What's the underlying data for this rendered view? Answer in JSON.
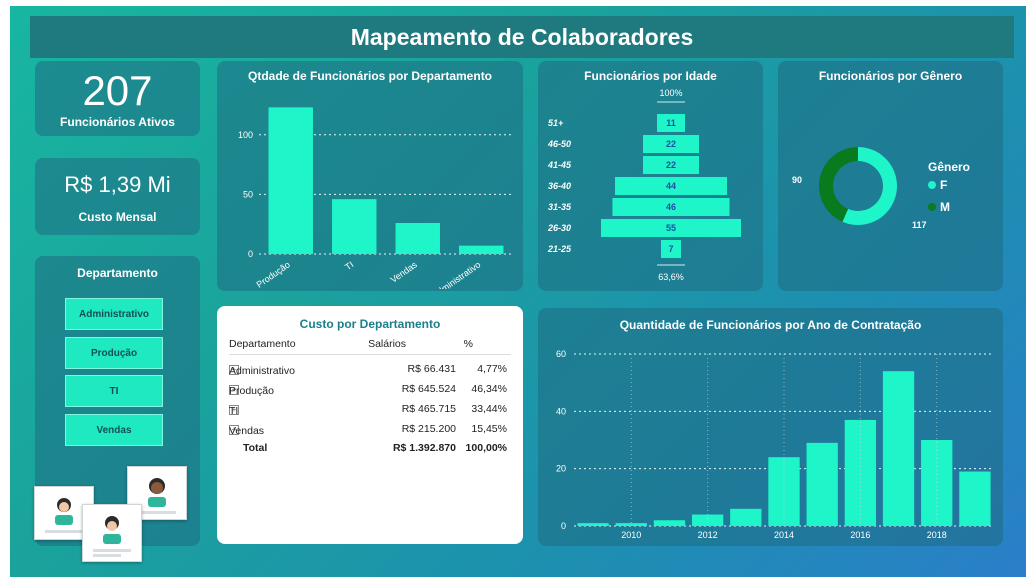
{
  "title": "Mapeamento de Colaboradores",
  "kpis": {
    "employees_value": "207",
    "employees_label": "Funcionários Ativos",
    "cost_value": "R$ 1,39 Mi",
    "cost_label": "Custo Mensal"
  },
  "slicer": {
    "title": "Departamento",
    "items": [
      "Administrativo",
      "Produção",
      "TI",
      "Vendas"
    ]
  },
  "colors": {
    "bar": "#1ef5c8",
    "title_bar": "#1f7a80",
    "male": "#0a7a1e",
    "female": "#1ef5c8"
  },
  "table": {
    "title": "Custo por Departamento",
    "headers": [
      "Departamento",
      "Salários",
      "%"
    ],
    "rows": [
      [
        "Administrativo",
        "R$ 66.431",
        "4,77%"
      ],
      [
        "Produção",
        "R$ 645.524",
        "46,34%"
      ],
      [
        "TI",
        "R$ 465.715",
        "33,44%"
      ],
      [
        "Vendas",
        "R$ 215.200",
        "15,45%"
      ]
    ],
    "total": [
      "Total",
      "R$ 1.392.870",
      "100,00%"
    ],
    "expand_icon": "plus-square-icon"
  },
  "chart_data": [
    {
      "type": "bar",
      "title": "Qtdade de Funcionários por Departamento",
      "categories": [
        "Produção",
        "TI",
        "Vendas",
        "Administrativo"
      ],
      "values": [
        123,
        46,
        26,
        7
      ],
      "yticks": [
        "0",
        "50",
        "100"
      ],
      "ylim": [
        0,
        130
      ],
      "grid": true
    },
    {
      "type": "bar",
      "title": "Funcionários por Idade",
      "categories": [
        "51+",
        "46-50",
        "41-45",
        "36-40",
        "31-35",
        "26-30",
        "21-25"
      ],
      "values": [
        11,
        22,
        22,
        44,
        46,
        55,
        7
      ],
      "top_label": "100%",
      "bottom_label": "63,6%"
    },
    {
      "type": "pie",
      "title": "Funcionários por Gênero",
      "legend_title": "Gênero",
      "categories": [
        "F",
        "M"
      ],
      "values": [
        117,
        90
      ],
      "legend": "right"
    },
    {
      "type": "bar",
      "title": "Quantidade de Funcionários por Ano de Contratação",
      "x": [
        2009,
        2010,
        2011,
        2012,
        2013,
        2014,
        2015,
        2016,
        2017,
        2018,
        2019
      ],
      "values": [
        1,
        1,
        2,
        4,
        6,
        24,
        29,
        37,
        54,
        30,
        19
      ],
      "xticks": [
        "2010",
        "2012",
        "2014",
        "2016",
        "2018"
      ],
      "yticks": [
        "0",
        "20",
        "40",
        "60"
      ],
      "ylim": [
        0,
        60
      ],
      "grid": true
    }
  ]
}
